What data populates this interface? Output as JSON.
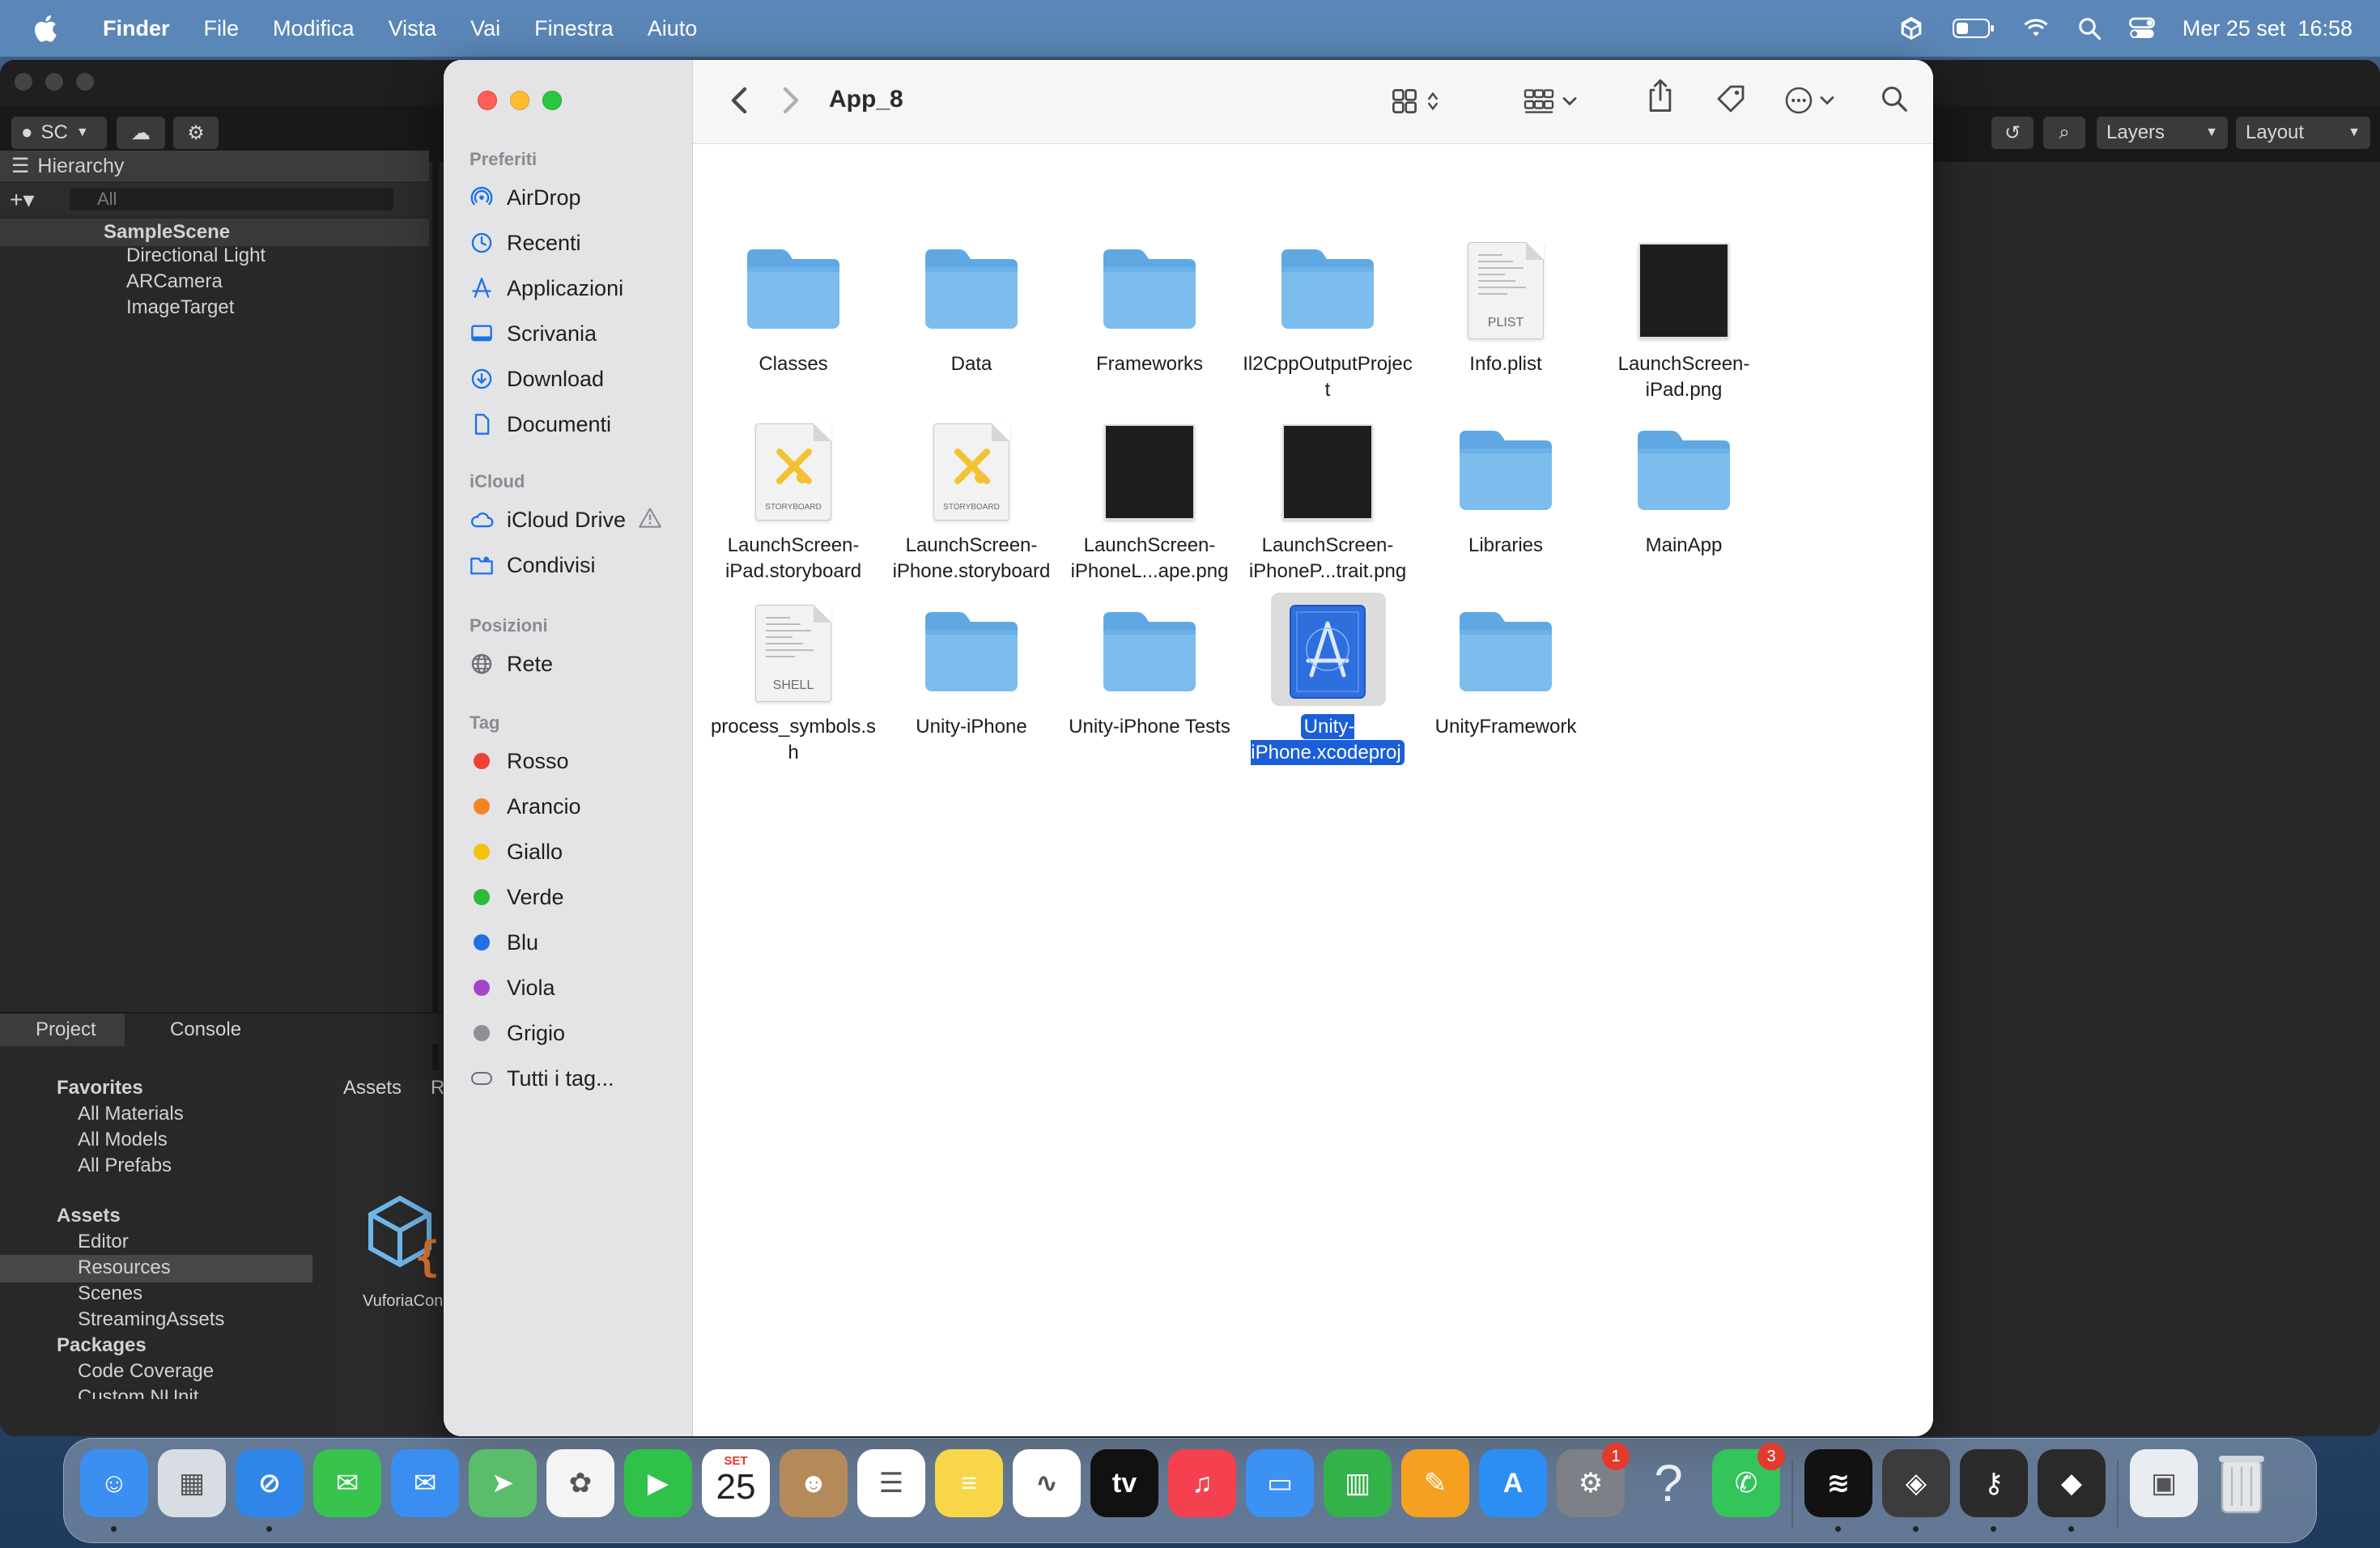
{
  "menubar": {
    "app_name": "Finder",
    "menus": [
      "File",
      "Modifica",
      "Vista",
      "Vai",
      "Finestra",
      "Aiuto"
    ],
    "clock": "Mer 25 set  16:58"
  },
  "unity": {
    "account": "SC",
    "layers_label": "Layers",
    "layout_label": "Layout",
    "hierarchy": {
      "title": "Hierarchy",
      "search_placeholder": "All",
      "scene": "SampleScene",
      "objects": [
        "Directional Light",
        "ARCamera",
        "ImageTarget"
      ]
    },
    "project": {
      "tab_project": "Project",
      "tab_console": "Console",
      "favorites": "Favorites",
      "favorite_items": [
        "All Materials",
        "All Models",
        "All Prefabs"
      ],
      "assets": "Assets",
      "asset_folders": [
        "Editor",
        "Resources",
        "Scenes",
        "StreamingAssets"
      ],
      "packages": "Packages",
      "package_folders": [
        "Code Coverage",
        "Custom NUnit"
      ],
      "breadcrumb_root": "Assets",
      "breadcrumb_next": "R",
      "asset_preview_label": "VuforiaCon"
    }
  },
  "finder": {
    "title": "App_8",
    "sidebar": {
      "favorites_header": "Preferiti",
      "favorites": [
        {
          "label": "AirDrop",
          "icon": "airdrop-icon"
        },
        {
          "label": "Recenti",
          "icon": "clock-icon"
        },
        {
          "label": "Applicazioni",
          "icon": "applications-icon"
        },
        {
          "label": "Scrivania",
          "icon": "desktop-icon"
        },
        {
          "label": "Download",
          "icon": "download-icon"
        },
        {
          "label": "Documenti",
          "icon": "document-icon"
        }
      ],
      "icloud_header": "iCloud",
      "icloud": [
        {
          "label": "iCloud Drive",
          "icon": "cloud-icon"
        },
        {
          "label": "Condivisi",
          "icon": "shared-folder-icon"
        }
      ],
      "locations_header": "Posizioni",
      "locations": [
        {
          "label": "Rete",
          "icon": "globe-icon"
        }
      ],
      "tags_header": "Tag",
      "tags": [
        {
          "label": "Rosso",
          "color": "#ee4035"
        },
        {
          "label": "Arancio",
          "color": "#f58523"
        },
        {
          "label": "Giallo",
          "color": "#f4c20d"
        },
        {
          "label": "Verde",
          "color": "#2cba3a"
        },
        {
          "label": "Blu",
          "color": "#1f6fe5"
        },
        {
          "label": "Viola",
          "color": "#a246c9"
        },
        {
          "label": "Grigio",
          "color": "#8e8e93"
        }
      ],
      "all_tags": "Tutti i tag..."
    },
    "files": [
      {
        "name": "Classes",
        "kind": "folder"
      },
      {
        "name": "Data",
        "kind": "folder"
      },
      {
        "name": "Frameworks",
        "kind": "folder"
      },
      {
        "name": "Il2CppOutputProject",
        "kind": "folder"
      },
      {
        "name": "Info.plist",
        "kind": "doc",
        "badge": "PLIST"
      },
      {
        "name": "LaunchScreen-iPad.png",
        "kind": "png"
      },
      {
        "name": "LaunchScreen-iPad.storyboard",
        "kind": "storyboard",
        "badge": "STORYBOARD"
      },
      {
        "name": "LaunchScreen-iPhone.storyboard",
        "kind": "storyboard",
        "badge": "STORYBOARD"
      },
      {
        "name": "LaunchScreen-iPhoneL...ape.png",
        "kind": "png"
      },
      {
        "name": "LaunchScreen-iPhoneP...trait.png",
        "kind": "png"
      },
      {
        "name": "Libraries",
        "kind": "folder"
      },
      {
        "name": "MainApp",
        "kind": "folder"
      },
      {
        "name": "process_symbols.sh",
        "kind": "doc",
        "badge": "SHELL"
      },
      {
        "name": "Unity-iPhone",
        "kind": "folder"
      },
      {
        "name": "Unity-iPhone Tests",
        "kind": "folder"
      },
      {
        "name": "Unity-iPhone.xcodeproj",
        "kind": "xcodeproj",
        "selected": true
      },
      {
        "name": "UnityFramework",
        "kind": "folder"
      }
    ]
  },
  "dock": {
    "calendar_month": "SET",
    "calendar_day": "25",
    "settings_badge": "1",
    "whatsapp_badge": "3",
    "apps": [
      {
        "name": "Finder",
        "icon": "finder-icon",
        "color": "#3b8ff0"
      },
      {
        "name": "Launchpad",
        "icon": "launchpad-icon",
        "color": "#d8dde4"
      },
      {
        "name": "Safari",
        "icon": "safari-icon",
        "color": "#2f86e8"
      },
      {
        "name": "Messages",
        "icon": "messages-icon",
        "color": "#37c34c"
      },
      {
        "name": "Mail",
        "icon": "mail-icon",
        "color": "#3a8ef2"
      },
      {
        "name": "Maps",
        "icon": "maps-icon",
        "color": "#5bbd6b"
      },
      {
        "name": "Photos",
        "icon": "photos-icon",
        "color": "#f4f4f4"
      },
      {
        "name": "FaceTime",
        "icon": "facetime-icon",
        "color": "#2fc14a"
      },
      {
        "name": "Calendar",
        "icon": "calendar-icon",
        "color": "#ffffff"
      },
      {
        "name": "Contacts",
        "icon": "contacts-icon",
        "color": "#b58a5b"
      },
      {
        "name": "Reminders",
        "icon": "reminders-icon",
        "color": "#ffffff"
      },
      {
        "name": "Notes",
        "icon": "notes-icon",
        "color": "#f7d64a"
      },
      {
        "name": "Freeform",
        "icon": "freeform-icon",
        "color": "#ffffff"
      },
      {
        "name": "TV",
        "icon": "tv-icon",
        "color": "#111111"
      },
      {
        "name": "Music",
        "icon": "music-icon",
        "color": "#f4404f"
      },
      {
        "name": "Keynote",
        "icon": "keynote-icon",
        "color": "#3b92f3"
      },
      {
        "name": "Numbers",
        "icon": "numbers-icon",
        "color": "#33b24a"
      },
      {
        "name": "Pages",
        "icon": "pages-icon",
        "color": "#f6a021"
      },
      {
        "name": "App Store",
        "icon": "app-store-icon",
        "color": "#2c8ef3"
      },
      {
        "name": "System Settings",
        "icon": "settings-icon",
        "color": "#7d8086"
      },
      {
        "name": "Help",
        "icon": "help-icon",
        "color": "transparent"
      },
      {
        "name": "WhatsApp",
        "icon": "whatsapp-icon",
        "color": "#33c45a"
      },
      {
        "name": "Spotify",
        "icon": "spotify-icon",
        "color": "#121212"
      },
      {
        "name": "Unity Hub",
        "icon": "unity-hub-icon",
        "color": "#3c3c3c"
      },
      {
        "name": "Keychain",
        "icon": "keychain-icon",
        "color": "#2b2b2b"
      },
      {
        "name": "Unity",
        "icon": "unity-icon",
        "color": "#2a2a2a"
      },
      {
        "name": "Screenshot",
        "icon": "screenshot-icon",
        "color": "#e9edf2"
      },
      {
        "name": "Trash",
        "icon": "trash-icon",
        "color": "transparent"
      }
    ]
  }
}
